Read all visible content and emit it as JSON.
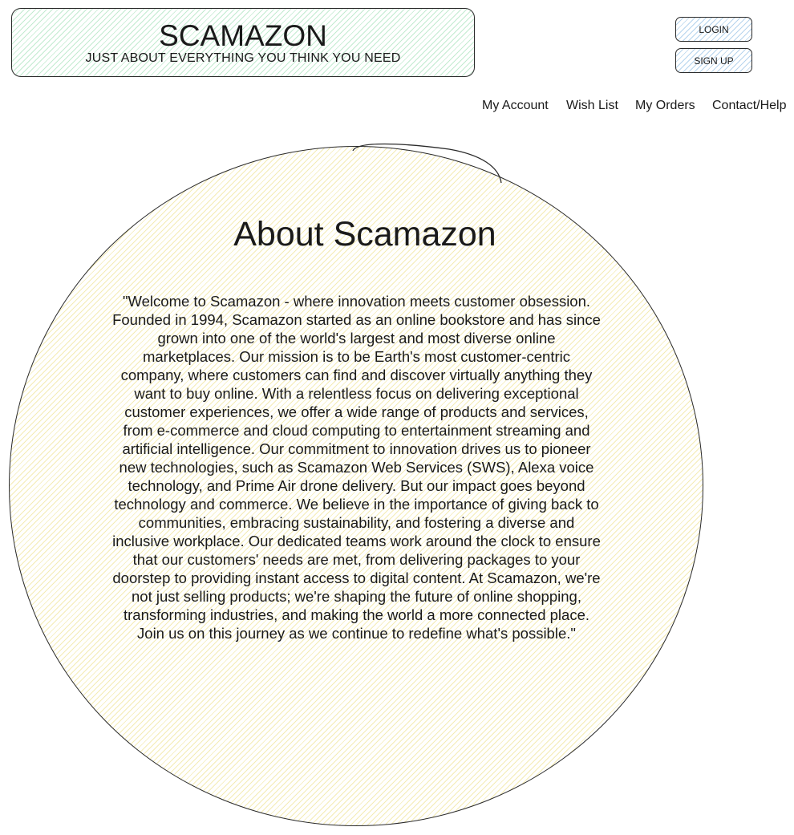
{
  "header": {
    "brand_name": "SCAMAZON",
    "tagline": "JUST ABOUT EVERYTHING YOU THINK YOU NEED"
  },
  "auth": {
    "login_label": "LOGIN",
    "signup_label": "SIGN UP"
  },
  "nav": {
    "my_account": "My Account",
    "wish_list": "Wish List",
    "my_orders": "My Orders",
    "contact_help": "Contact/Help"
  },
  "about": {
    "title": "About Scamazon",
    "body": "\"Welcome to Scamazon - where innovation meets customer obsession. Founded in 1994, Scamazon started as an online bookstore and has since grown into one of the world's largest and most diverse online marketplaces. Our mission is to be Earth's most customer-centric company, where customers can find and discover virtually anything they want to buy online. With a relentless focus on delivering exceptional customer experiences, we offer a wide range of products and services, from e-commerce and cloud computing to entertainment streaming and artificial intelligence. Our commitment to innovation drives us to pioneer new technologies, such as Scamazon Web Services (SWS), Alexa voice technology, and Prime Air drone delivery. But our impact goes beyond technology and commerce. We believe in the importance of giving back to communities, embracing sustainability, and fostering a diverse and inclusive workplace. Our dedicated teams work around the clock to ensure that our customers' needs are met, from delivering packages to your doorstep to providing instant access to digital content. At Scamazon, we're not just selling products; we're shaping the future of online shopping, transforming industries, and making the world a more connected place. Join us on this journey as we continue to redefine what's possible.\""
  },
  "colors": {
    "header_hatch": "#78d296",
    "button_hatch": "#6eaadc",
    "circle_hatch": "#ebdc78",
    "stroke": "#2a2a2a",
    "text": "#1a1a1a"
  }
}
